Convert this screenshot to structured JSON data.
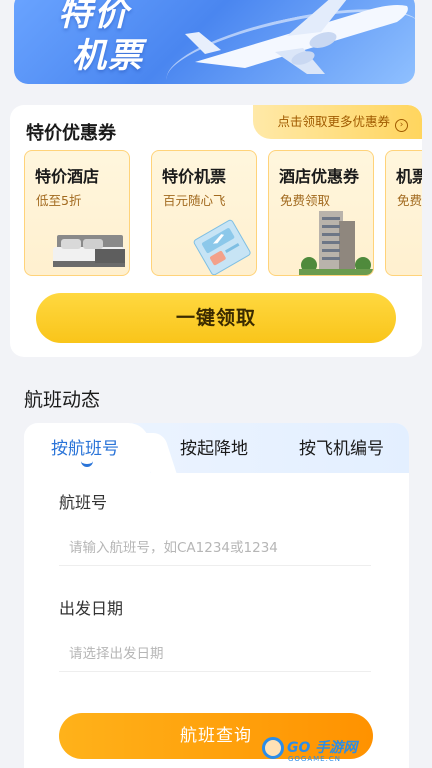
{
  "banner": {
    "line1": "特价",
    "line2": "机票"
  },
  "coupons": {
    "title": "特价优惠券",
    "more_link": "点击领取更多优惠券",
    "items": [
      {
        "title": "特价酒店",
        "subtitle": "低至5折",
        "icon": "bed-icon"
      },
      {
        "title": "特价机票",
        "subtitle": "百元随心飞",
        "icon": "ticket-icon"
      },
      {
        "title": "酒店优惠券",
        "subtitle": "免费领取",
        "icon": "building-icon"
      },
      {
        "title": "机票",
        "subtitle": "免费",
        "icon": "ticket-icon"
      }
    ],
    "claim_button": "一键领取"
  },
  "flight_status": {
    "title": "航班动态",
    "tabs": [
      {
        "label": "按航班号",
        "active": true
      },
      {
        "label": "按起降地",
        "active": false
      },
      {
        "label": "按飞机编号",
        "active": false
      }
    ],
    "fields": [
      {
        "label": "航班号",
        "placeholder": "请输入航班号，如CA1234或1234",
        "value": ""
      },
      {
        "label": "出发日期",
        "placeholder": "请选择出发日期",
        "value": ""
      }
    ],
    "query_button": "航班查询"
  },
  "watermark": {
    "text": "GO 手游网",
    "sub": "GOGAME.CN"
  },
  "colors": {
    "accent_blue": "#2a74d8",
    "claim_yellow": "#f9c51a",
    "query_orange": "#ff9a00"
  }
}
